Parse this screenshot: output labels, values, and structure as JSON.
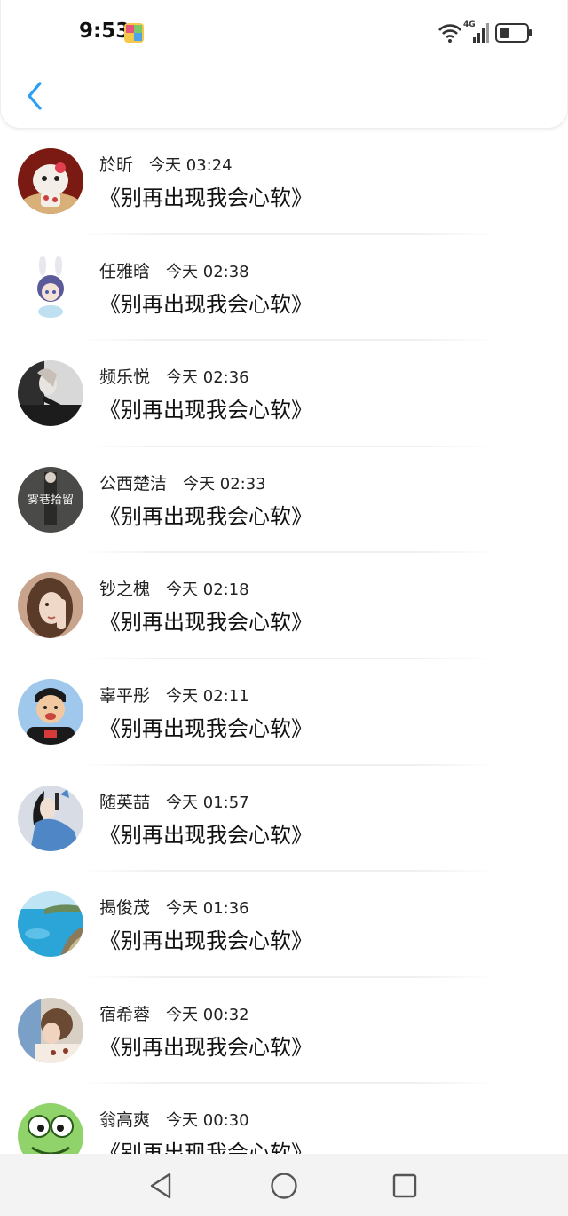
{
  "status_bar": {
    "time": "9:53",
    "network_label": "4G",
    "icons": [
      "app-notification-icon",
      "wifi-icon",
      "signal-icon",
      "battery-icon"
    ]
  },
  "header": {
    "back_icon": "chevron-left-icon",
    "accent_color": "#2a9df4"
  },
  "messages": [
    {
      "name": "於昕",
      "time": "今天 03:24",
      "text": "《别再出现我会心软》",
      "avatar_color": "#7a1a12"
    },
    {
      "name": "任雅晗",
      "time": "今天 02:38",
      "text": "《别再出现我会心软》",
      "avatar_color": "#e8ecf4"
    },
    {
      "name": "频乐悦",
      "time": "今天 02:36",
      "text": "《别再出现我会心软》",
      "avatar_color": "#3a3a3a"
    },
    {
      "name": "公西楚洁",
      "time": "今天 02:33",
      "text": "《别再出现我会心软》",
      "avatar_color": "#4a4a48",
      "avatar_text": "雾巷拾留"
    },
    {
      "name": "钞之槐",
      "time": "今天 02:18",
      "text": "《别再出现我会心软》",
      "avatar_color": "#c9a48c"
    },
    {
      "name": "辜平彤",
      "time": "今天 02:11",
      "text": "《别再出现我会心软》",
      "avatar_color": "#9fc8ec"
    },
    {
      "name": "随英喆",
      "time": "今天 01:57",
      "text": "《别再出现我会心软》",
      "avatar_color": "#4f86c6"
    },
    {
      "name": "揭俊茂",
      "time": "今天 01:36",
      "text": "《别再出现我会心软》",
      "avatar_color": "#2ba4d8"
    },
    {
      "name": "宿希蓉",
      "time": "今天 00:32",
      "text": "《别再出现我会心软》",
      "avatar_color": "#8a6a52"
    },
    {
      "name": "翁高爽",
      "time": "今天 00:30",
      "text": "《别再出现我会心软》",
      "avatar_color": "#8fd36a"
    }
  ],
  "nav_bar": {
    "icons": [
      "back-triangle-icon",
      "home-circle-icon",
      "recents-square-icon"
    ]
  }
}
